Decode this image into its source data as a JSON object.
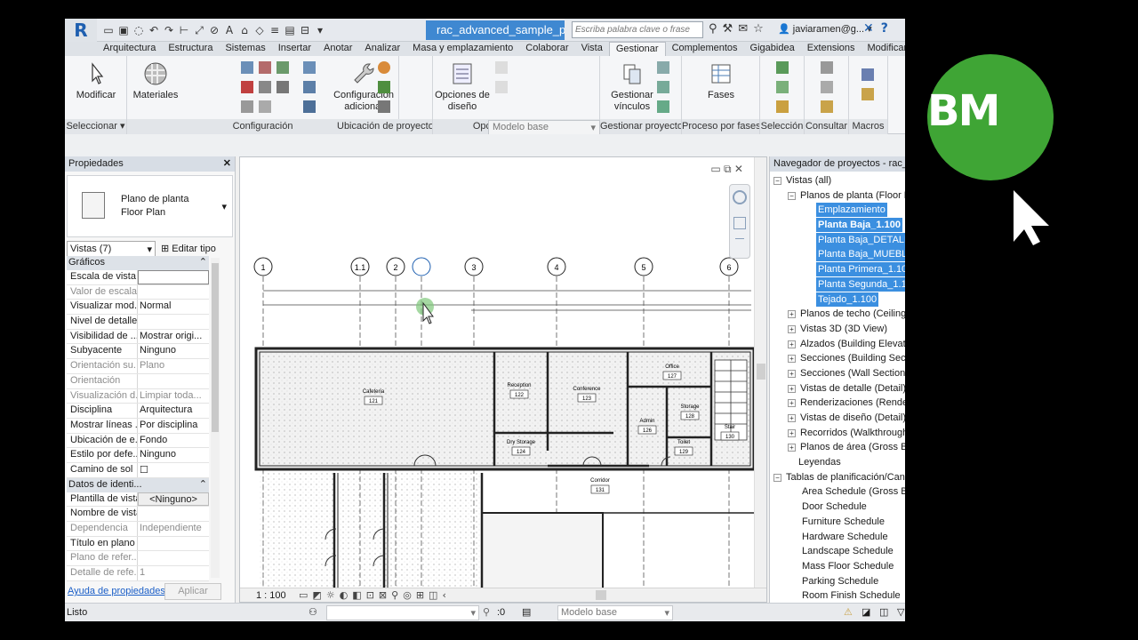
{
  "titlebar": {
    "file_tab": "rac_advanced_sample_p...",
    "search_placeholder": "Escriba palabra clave o frase",
    "user": "javiaramen@g..."
  },
  "ribbon_tabs": [
    "Arquitectura",
    "Estructura",
    "Sistemas",
    "Insertar",
    "Anotar",
    "Analizar",
    "Masa y emplazamiento",
    "Colaborar",
    "Vista",
    "Gestionar",
    "Complementos",
    "Gigabidea",
    "Extensions",
    "Modificar"
  ],
  "active_tab": "Gestionar",
  "ribbon": {
    "modificar": "Modificar",
    "materiales": "Materiales",
    "config_adicional_1": "Configuración",
    "config_adicional_2": "adicional",
    "opciones_diseno_1": "Opciones de",
    "opciones_diseno_2": "diseño",
    "modelo_base": "Modelo base",
    "gestionar_vinculos_1": "Gestionar",
    "gestionar_vinculos_2": "vínculos",
    "fases": "Fases",
    "panels": {
      "seleccionar": "Seleccionar",
      "configuracion": "Configuración",
      "ubicacion": "Ubicación de proyecto",
      "opciones": "Opciones de diseño",
      "gestionar": "Gestionar proyecto",
      "proceso": "Proceso por fases",
      "seleccion": "Selección",
      "consultar": "Consultar",
      "macros": "Macros"
    }
  },
  "properties": {
    "title": "Propiedades",
    "type_line1": "Plano de planta",
    "type_line2": "Floor Plan",
    "filter": "Vistas (7)",
    "edit_type": "Editar tipo",
    "section_graphics": "Gráficos",
    "rows_graphics": [
      {
        "k": "Escala de vista",
        "v": "",
        "dim": false
      },
      {
        "k": "Valor de escala...",
        "v": "",
        "dim": true
      },
      {
        "k": "Visualizar mod...",
        "v": "Normal",
        "dim": false
      },
      {
        "k": "Nivel de detalle",
        "v": "",
        "dim": false
      },
      {
        "k": "Visibilidad de ...",
        "v": "Mostrar origi...",
        "dim": false
      },
      {
        "k": "Subyacente",
        "v": "Ninguno",
        "dim": false
      },
      {
        "k": "Orientación su...",
        "v": "Plano",
        "dim": true
      },
      {
        "k": "Orientación",
        "v": "",
        "dim": true
      },
      {
        "k": "Visualización d...",
        "v": "Limpiar toda...",
        "dim": true
      },
      {
        "k": "Disciplina",
        "v": "Arquitectura",
        "dim": false
      },
      {
        "k": "Mostrar líneas ...",
        "v": "Por disciplina",
        "dim": false
      },
      {
        "k": "Ubicación de e...",
        "v": "Fondo",
        "dim": false
      },
      {
        "k": "Estilo por defe...",
        "v": "Ninguno",
        "dim": false
      },
      {
        "k": "Camino de sol",
        "v": "☐",
        "dim": false
      }
    ],
    "section_identity": "Datos de identi...",
    "rows_identity": [
      {
        "k": "Plantilla de vista",
        "v": "<Ninguno>",
        "dim": false
      },
      {
        "k": "Nombre de vista",
        "v": "",
        "dim": false
      },
      {
        "k": "Dependencia",
        "v": "Independiente",
        "dim": true
      },
      {
        "k": "Título en plano",
        "v": "",
        "dim": false
      },
      {
        "k": "Plano de refer...",
        "v": "",
        "dim": true
      },
      {
        "k": "Detalle de refe...",
        "v": "1",
        "dim": true
      }
    ],
    "help_link": "Ayuda de propiedades",
    "apply": "Aplicar"
  },
  "canvas": {
    "scale": "1 : 100",
    "grid_labels": [
      "1",
      "1.1",
      "2",
      "3",
      "4",
      "5",
      "6"
    ],
    "rooms": [
      {
        "name": "Cafeteria",
        "num": "121"
      },
      {
        "name": "Reception",
        "num": "122"
      },
      {
        "name": "Conference",
        "num": "123"
      },
      {
        "name": "Office",
        "num": "127"
      },
      {
        "name": "Storage",
        "num": "128"
      },
      {
        "name": "Admin",
        "num": "126"
      },
      {
        "name": "Toilet",
        "num": "129"
      },
      {
        "name": "Dry Storage",
        "num": "124"
      },
      {
        "name": "Corridor",
        "num": "131"
      },
      {
        "name": "Stair",
        "num": "130"
      }
    ]
  },
  "browser": {
    "title": "Navegador de proyectos - rac_advan",
    "items": [
      {
        "label": "Vistas (all)",
        "indent": 0,
        "toggle": "−",
        "sel": false,
        "bold": false
      },
      {
        "label": "Planos de planta (Floor Pla",
        "indent": 1,
        "toggle": "−",
        "sel": false,
        "bold": false
      },
      {
        "label": "Emplazamiento",
        "indent": 2,
        "toggle": "",
        "sel": true,
        "bold": false
      },
      {
        "label": "Planta Baja_1.100",
        "indent": 2,
        "toggle": "",
        "sel": true,
        "bold": true
      },
      {
        "label": "Planta Baja_DETALLE1",
        "indent": 2,
        "toggle": "",
        "sel": true,
        "bold": false
      },
      {
        "label": "Planta Baja_MUEBLES",
        "indent": 2,
        "toggle": "",
        "sel": true,
        "bold": false
      },
      {
        "label": "Planta Primera_1.100",
        "indent": 2,
        "toggle": "",
        "sel": true,
        "bold": false
      },
      {
        "label": "Planta Segunda_1.100",
        "indent": 2,
        "toggle": "",
        "sel": true,
        "bold": false
      },
      {
        "label": "Tejado_1.100",
        "indent": 2,
        "toggle": "",
        "sel": true,
        "bold": false
      },
      {
        "label": "Planos de techo (Ceiling P",
        "indent": 1,
        "toggle": "+",
        "sel": false,
        "bold": false
      },
      {
        "label": "Vistas 3D (3D View)",
        "indent": 1,
        "toggle": "+",
        "sel": false,
        "bold": false
      },
      {
        "label": "Alzados (Building Elevatio",
        "indent": 1,
        "toggle": "+",
        "sel": false,
        "bold": false
      },
      {
        "label": "Secciones (Building Sectio",
        "indent": 1,
        "toggle": "+",
        "sel": false,
        "bold": false
      },
      {
        "label": "Secciones (Wall Section)",
        "indent": 1,
        "toggle": "+",
        "sel": false,
        "bold": false
      },
      {
        "label": "Vistas de detalle (Detail)",
        "indent": 1,
        "toggle": "+",
        "sel": false,
        "bold": false
      },
      {
        "label": "Renderizaciones (Renderin",
        "indent": 1,
        "toggle": "+",
        "sel": false,
        "bold": false
      },
      {
        "label": "Vistas de diseño (Detail)",
        "indent": 1,
        "toggle": "+",
        "sel": false,
        "bold": false
      },
      {
        "label": "Recorridos (Walkthrough)",
        "indent": 1,
        "toggle": "+",
        "sel": false,
        "bold": false
      },
      {
        "label": "Planos de área (Gross Buil",
        "indent": 1,
        "toggle": "+",
        "sel": false,
        "bold": false
      },
      {
        "label": "Leyendas",
        "indent": 0,
        "toggle": "",
        "sel": false,
        "bold": false
      },
      {
        "label": "Tablas de planificación/Can",
        "indent": 0,
        "toggle": "−",
        "sel": false,
        "bold": false
      },
      {
        "label": "Area Schedule (Gross Build",
        "indent": 1,
        "toggle": "",
        "sel": false,
        "bold": false
      },
      {
        "label": "Door Schedule",
        "indent": 1,
        "toggle": "",
        "sel": false,
        "bold": false
      },
      {
        "label": "Furniture Schedule",
        "indent": 1,
        "toggle": "",
        "sel": false,
        "bold": false
      },
      {
        "label": "Hardware Schedule",
        "indent": 1,
        "toggle": "",
        "sel": false,
        "bold": false
      },
      {
        "label": "Landscape Schedule",
        "indent": 1,
        "toggle": "",
        "sel": false,
        "bold": false
      },
      {
        "label": "Mass Floor Schedule",
        "indent": 1,
        "toggle": "",
        "sel": false,
        "bold": false
      },
      {
        "label": "Parking Schedule",
        "indent": 1,
        "toggle": "",
        "sel": false,
        "bold": false
      },
      {
        "label": "Room Finish Schedule",
        "indent": 1,
        "toggle": "",
        "sel": false,
        "bold": false
      }
    ]
  },
  "statusbar": {
    "ready": "Listo",
    "zero": ":0",
    "model": "Modelo base"
  },
  "brand": {
    "logo_text": "BM",
    "color": "#3fa535"
  },
  "colors": {
    "accent": "#3f88d1",
    "selection": "#3b8fe0"
  }
}
